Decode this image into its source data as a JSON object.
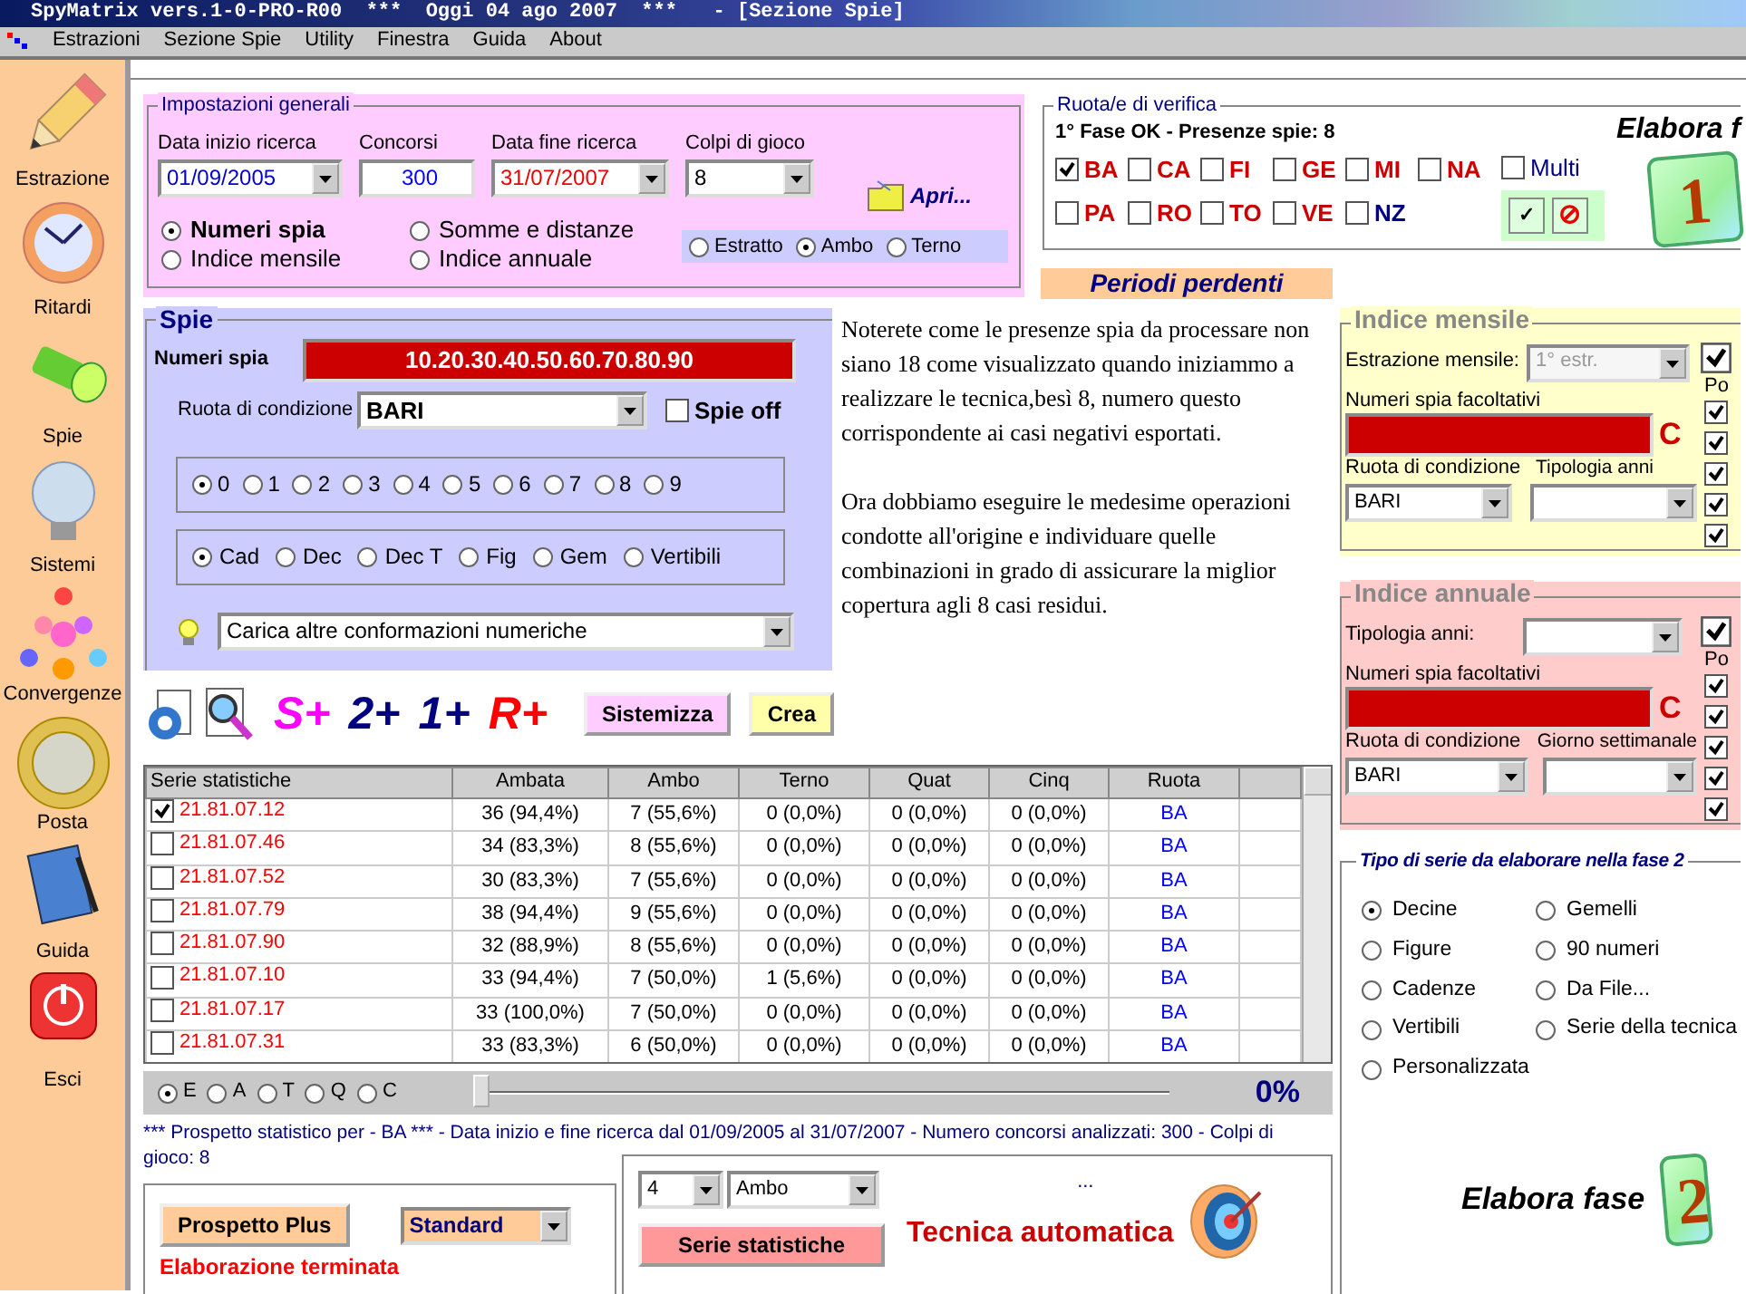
{
  "window": {
    "title": "SpyMatrix vers.1-0-PRO-R00  ***  Oggi 04 ago 2007  ***   - [Sezione Spie]"
  },
  "menu": [
    "Estrazioni",
    "Sezione Spie",
    "Utility",
    "Finestra",
    "Guida",
    "About"
  ],
  "sidebar": [
    {
      "label": "Estrazione",
      "kind": "pencil"
    },
    {
      "label": "Ritardi",
      "kind": "clock"
    },
    {
      "label": "Spie",
      "kind": "torch"
    },
    {
      "label": "Sistemi",
      "kind": "bulb"
    },
    {
      "label": "Convergenze",
      "kind": "dots"
    },
    {
      "label": "Posta",
      "kind": "coin"
    },
    {
      "label": "Guida",
      "kind": "book"
    },
    {
      "label": "Esci",
      "kind": "power"
    }
  ],
  "general": {
    "title": "Impostazioni generali",
    "fields": [
      {
        "label": "Data inizio ricerca",
        "value": "01/09/2005",
        "kind": "combo",
        "color": "#0000cc"
      },
      {
        "label": "Concorsi",
        "value": "300",
        "kind": "text",
        "color": "#0000ff"
      },
      {
        "label": "Data fine ricerca",
        "value": "31/07/2007",
        "kind": "combo",
        "color": "#ee0000"
      },
      {
        "label": "Colpi di gioco",
        "value": "8",
        "kind": "combo",
        "color": "#000000"
      }
    ],
    "modes": [
      {
        "label": "Numeri spia",
        "selected": true
      },
      {
        "label": "Indice mensile",
        "selected": false
      },
      {
        "label": "Somme e distanze",
        "selected": false
      },
      {
        "label": "Indice annuale",
        "selected": false
      }
    ],
    "open_link": "Apri...",
    "play": [
      {
        "label": "Estratto",
        "selected": false
      },
      {
        "label": "Ambo",
        "selected": true
      },
      {
        "label": "Terno",
        "selected": false
      }
    ]
  },
  "wheels": {
    "title": "Ruota/e di verifica",
    "status": "1° Fase OK - Presenze spie: 8",
    "items": [
      {
        "label": "BA",
        "checked": true,
        "color": "#cc0000"
      },
      {
        "label": "CA",
        "checked": false,
        "color": "#cc0000"
      },
      {
        "label": "FI",
        "checked": false,
        "color": "#cc0000"
      },
      {
        "label": "GE",
        "checked": false,
        "color": "#cc0000"
      },
      {
        "label": "MI",
        "checked": false,
        "color": "#cc0000"
      },
      {
        "label": "NA",
        "checked": false,
        "color": "#cc0000"
      },
      {
        "label": "PA",
        "checked": false,
        "color": "#cc0000"
      },
      {
        "label": "RO",
        "checked": false,
        "color": "#cc0000"
      },
      {
        "label": "TO",
        "checked": false,
        "color": "#cc0000"
      },
      {
        "label": "VE",
        "checked": false,
        "color": "#cc0000"
      },
      {
        "label": "NZ",
        "checked": false,
        "color": "#000080"
      }
    ],
    "multi": {
      "label": "Multi",
      "checked": false
    },
    "confirm": "✓",
    "cancel": "⊘",
    "run_label": "Elabora f",
    "badge": "1"
  },
  "losing_periods": "Periodi perdenti",
  "spie": {
    "title": "Spie",
    "numbers_label": "Numeri spia",
    "numbers": "10.20.30.40.50.60.70.80.90",
    "wheel_label": "Ruota di condizione",
    "wheel": "BARI",
    "off": {
      "label": "Spie off",
      "checked": false
    },
    "digits": [
      {
        "label": "0",
        "selected": true
      },
      {
        "label": "1",
        "selected": false
      },
      {
        "label": "2",
        "selected": false
      },
      {
        "label": "3",
        "selected": false
      },
      {
        "label": "4",
        "selected": false
      },
      {
        "label": "5",
        "selected": false
      },
      {
        "label": "6",
        "selected": false
      },
      {
        "label": "7",
        "selected": false
      },
      {
        "label": "8",
        "selected": false
      },
      {
        "label": "9",
        "selected": false
      }
    ],
    "groups": [
      {
        "label": "Cad",
        "selected": true
      },
      {
        "label": "Dec",
        "selected": false
      },
      {
        "label": "Dec T",
        "selected": false
      },
      {
        "label": "Fig",
        "selected": false
      },
      {
        "label": "Gem",
        "selected": false
      },
      {
        "label": "Vertibili",
        "selected": false
      }
    ],
    "more": "Carica altre conformazioni numeriche"
  },
  "toolbar": {
    "tools": [
      {
        "label": "S+",
        "color": "#ff00ff"
      },
      {
        "label": "2+",
        "color": "#000080"
      },
      {
        "label": "1+",
        "color": "#000080"
      },
      {
        "label": "R+",
        "color": "#ff0000"
      }
    ],
    "buttons": [
      "Sistemizza",
      "Crea"
    ]
  },
  "note": [
    "Noterete come le presenze spia da processare non siano 18 come visualizzato quando iniziammo a realizzare le tecnica,besì 8, numero questo corrispondente ai casi negativi esportati.",
    "Ora dobbiamo eseguire le medesime operazioni condotte all'origine e individuare quelle combinazioni in grado di assicurare la miglior copertura agli 8 casi residui."
  ],
  "table": {
    "columns": [
      "Serie statistiche",
      "Ambata",
      "Ambo",
      "Terno",
      "Quat",
      "Cinq",
      "Ruota"
    ],
    "rows": [
      {
        "checked": true,
        "cells": [
          "21.81.07.12",
          "36 (94,4%)",
          "7 (55,6%)",
          "0 (0,0%)",
          "0 (0,0%)",
          "0 (0,0%)",
          "BA"
        ]
      },
      {
        "checked": false,
        "cells": [
          "21.81.07.46",
          "34 (83,3%)",
          "8 (55,6%)",
          "0 (0,0%)",
          "0 (0,0%)",
          "0 (0,0%)",
          "BA"
        ]
      },
      {
        "checked": false,
        "cells": [
          "21.81.07.52",
          "30 (83,3%)",
          "7 (55,6%)",
          "0 (0,0%)",
          "0 (0,0%)",
          "0 (0,0%)",
          "BA"
        ]
      },
      {
        "checked": false,
        "cells": [
          "21.81.07.79",
          "38 (94,4%)",
          "9 (55,6%)",
          "0 (0,0%)",
          "0 (0,0%)",
          "0 (0,0%)",
          "BA"
        ]
      },
      {
        "checked": false,
        "cells": [
          "21.81.07.90",
          "32 (88,9%)",
          "8 (55,6%)",
          "0 (0,0%)",
          "0 (0,0%)",
          "0 (0,0%)",
          "BA"
        ]
      },
      {
        "checked": false,
        "cells": [
          "21.81.07.10",
          "33 (94,4%)",
          "7 (50,0%)",
          "1 (5,6%)",
          "0 (0,0%)",
          "0 (0,0%)",
          "BA"
        ]
      },
      {
        "checked": false,
        "cells": [
          "21.81.07.17",
          "33 (100,0%)",
          "7 (50,0%)",
          "0 (0,0%)",
          "0 (0,0%)",
          "0 (0,0%)",
          "BA"
        ]
      },
      {
        "checked": false,
        "cells": [
          "21.81.07.31",
          "33 (83,3%)",
          "6 (50,0%)",
          "0 (0,0%)",
          "0 (0,0%)",
          "0 (0,0%)",
          "BA"
        ]
      }
    ]
  },
  "slider": {
    "options": [
      {
        "label": "E",
        "selected": true
      },
      {
        "label": "A",
        "selected": false
      },
      {
        "label": "T",
        "selected": false
      },
      {
        "label": "Q",
        "selected": false
      },
      {
        "label": "C",
        "selected": false
      }
    ],
    "level": 0,
    "reading": "0%"
  },
  "summary": "*** Prospetto statistico per  - BA ***  - Data inizio e fine ricerca dal 01/09/2005 al 31/07/2007 - Numero concorsi analizzati: 300 - Colpi di gioco: 8",
  "report": {
    "button": "Prospetto Plus",
    "style": "Standard",
    "status": "Elaborazione terminata"
  },
  "auto": {
    "count": "4",
    "type": "Ambo",
    "dots": "...",
    "button": "Serie statistiche",
    "title": "Tecnica automatica"
  },
  "monthly": {
    "title": "Indice mensile",
    "extraction_label": "Estrazione mensile:",
    "extraction": "1° estr.",
    "extraction_disabled": true,
    "optional_label": "Numeri spia facoltativi",
    "clear": "C",
    "wheel_label": "Ruota di condizione",
    "wheel": "BARI",
    "second_label": "Tipologia anni",
    "side_label": "Po",
    "side_checks": [
      {
        "checked": true
      },
      {
        "checked": true
      },
      {
        "checked": true
      },
      {
        "checked": true
      },
      {
        "checked": true
      },
      {
        "checked": true
      }
    ]
  },
  "annual": {
    "title": "Indice annuale",
    "years_label": "Tipologia anni:",
    "optional_label": "Numeri spia facoltativi",
    "clear": "C",
    "wheel_label": "Ruota di condizione",
    "wheel": "BARI",
    "second_label": "Giorno settimanale",
    "side_label": "Po",
    "side_checks": [
      {
        "checked": true
      },
      {
        "checked": true
      },
      {
        "checked": true
      },
      {
        "checked": true
      },
      {
        "checked": true
      },
      {
        "checked": true
      }
    ]
  },
  "series_type": {
    "title": "Tipo di serie da elaborare nella fase 2",
    "options": [
      {
        "label": "Decine",
        "selected": true
      },
      {
        "label": "Gemelli",
        "selected": false
      },
      {
        "label": "Figure",
        "selected": false
      },
      {
        "label": "90 numeri",
        "selected": false
      },
      {
        "label": "Cadenze",
        "selected": false
      },
      {
        "label": "Da File...",
        "selected": false
      },
      {
        "label": "Vertibili",
        "selected": false
      },
      {
        "label": "Serie della tecnica",
        "selected": false
      },
      {
        "label": "Personalizzata",
        "selected": false
      }
    ],
    "run_label": "Elabora fase",
    "badge": "2"
  }
}
